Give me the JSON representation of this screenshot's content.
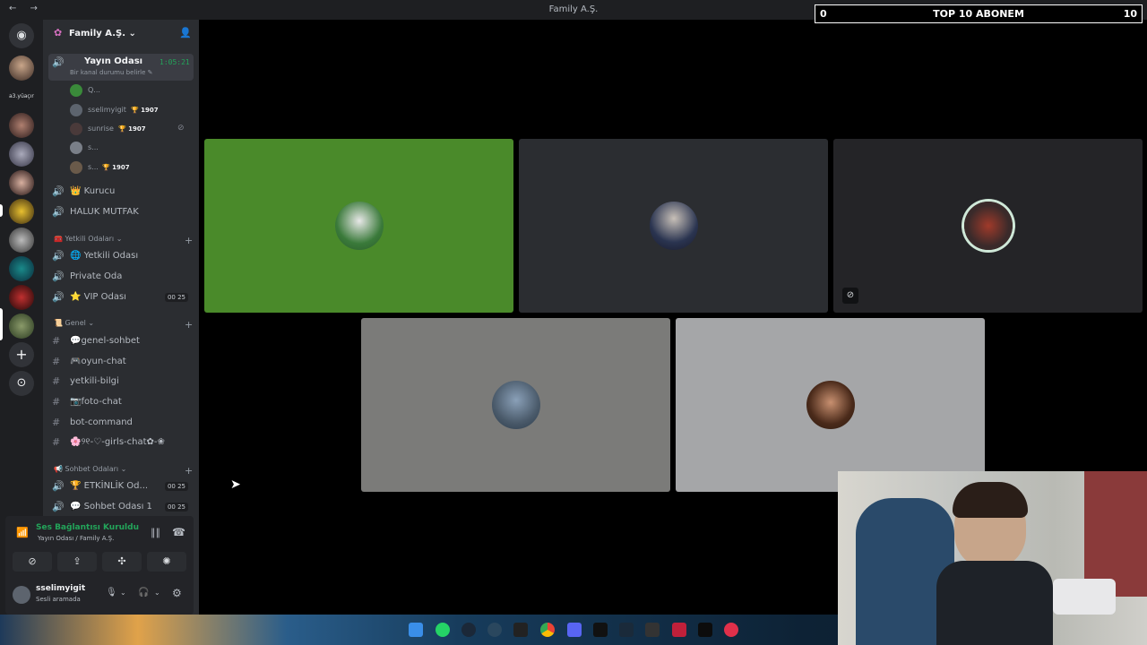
{
  "window": {
    "title": "Family A.Ş.",
    "nav": "← →"
  },
  "overlay": {
    "left_value": "0",
    "label": "TOP 10 ABONEM",
    "right_value": "10"
  },
  "server_rail": {
    "labels": [
      "a3.yüaçır"
    ]
  },
  "server": {
    "name": "Family A.Ş. ⌄"
  },
  "channels": {
    "active_voice": {
      "name": "Yayın Odası",
      "duration": "1:05:21",
      "status": "Bir kanal durumu belirle ✎"
    },
    "users": [
      {
        "name": "Q...",
        "trophy": ""
      },
      {
        "name": "sselimyigit",
        "trophy": "🏆 1907"
      },
      {
        "name": "sunrise",
        "trophy": "🏆 1907"
      },
      {
        "name": "s...",
        "trophy": ""
      },
      {
        "name": "s...",
        "trophy": "🏆 1907"
      }
    ],
    "voice_top": [
      {
        "name": "👑 Kurucu"
      },
      {
        "name": "HALUK MUTFAK"
      }
    ],
    "cat_yetkili": "🧰 Yetkili Odaları ⌄",
    "yetkili": [
      {
        "name": "🌐 Yetkili Odası",
        "badge": ""
      },
      {
        "name": "Private Oda",
        "badge": ""
      },
      {
        "name": "⭐ VIP Odası",
        "badge": "00 25"
      }
    ],
    "cat_genel": "📜 Genel ⌄",
    "genel": [
      {
        "name": "💬genel-sohbet"
      },
      {
        "name": "🎮oyun-chat"
      },
      {
        "name": "yetkili-bilgi"
      },
      {
        "name": "📷foto-chat"
      },
      {
        "name": "bot-command"
      },
      {
        "name": "🌸୨୧-♡-girls-chat✿-❀"
      }
    ],
    "cat_sohbet": "📢 Sohbet Odaları ⌄",
    "sohbet": [
      {
        "name": "🏆 ETKİNLİK Od...",
        "badge": "00 25"
      },
      {
        "name": "💬 Sohbet Odası 1",
        "badge": "00 25"
      }
    ]
  },
  "voice_panel": {
    "status": "Ses Bağlantısı Kuruldu",
    "subtitle": "Yayın Odası / Family A.Ş.",
    "user": "sselimyigit",
    "user_status": "Sesli aramada"
  },
  "colors": {
    "accent": "#5865f2",
    "online": "#23a55a",
    "green_tile": "#4a8a2a"
  }
}
